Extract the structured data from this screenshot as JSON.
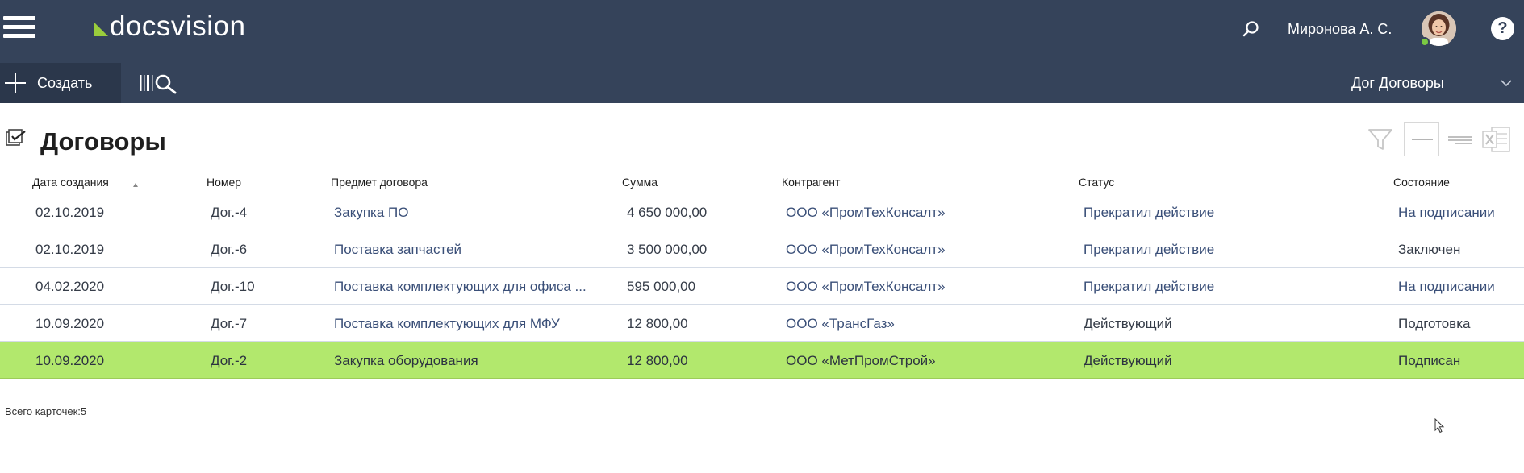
{
  "header": {
    "logo_text": "docsvision",
    "user_name": "Миронова А. С.",
    "help_label": "?",
    "brand_color": "#35435a",
    "logo_accent_color": "#9acd3c"
  },
  "toolbar": {
    "create_label": "Создать",
    "folder_label": "Дог Договоры"
  },
  "page": {
    "title": "Договоры"
  },
  "table": {
    "columns": [
      "Дата создания",
      "Номер",
      "Предмет договора",
      "Сумма",
      "Контрагент",
      "Статус",
      "Состояние"
    ],
    "sort_column": "Дата создания",
    "sort_direction": "ascending",
    "rows": [
      {
        "date": "02.10.2019",
        "number": "Дог.-4",
        "subject": "Закупка ПО",
        "amount": "4 650 000,00",
        "counterparty": "ООО «ПромТехКонсалт»",
        "status": "Прекратил действие",
        "state": "На подписании"
      },
      {
        "date": "02.10.2019",
        "number": "Дог.-6",
        "subject": "Поставка запчастей",
        "amount": "3 500 000,00",
        "counterparty": "ООО «ПромТехКонсалт»",
        "status": "Прекратил действие",
        "state": "Заключен"
      },
      {
        "date": "04.02.2020",
        "number": "Дог.-10",
        "subject": "Поставка комплектующих для офиса ...",
        "amount": "595 000,00",
        "counterparty": "ООО «ПромТехКонсалт»",
        "status": "Прекратил действие",
        "state": "На подписании"
      },
      {
        "date": "10.09.2020",
        "number": "Дог.-7",
        "subject": "Поставка комплектующих для МФУ",
        "amount": "12 800,00",
        "counterparty": "ООО «ТрансГаз»",
        "status": "Действующий",
        "state": "Подготовка"
      },
      {
        "date": "10.09.2020",
        "number": "Дог.-2",
        "subject": "Закупка оборудования",
        "amount": "12 800,00",
        "counterparty": "ООО «МетПромСтрой»",
        "status": "Действующий",
        "state": "Подписан"
      }
    ],
    "selected_row_index": 4,
    "selected_row_color": "#b2e86d"
  },
  "footer": {
    "count_text": "Всего карточек:5"
  },
  "icons": {
    "menu": "hamburger-menu-icon",
    "search": "search-icon",
    "create": "plus-icon",
    "barcode": "barcode-search-icon",
    "dropdown": "chevron-down-icon",
    "title": "checklist-icon",
    "filter": "filter-icon",
    "export": "excel-icon"
  }
}
